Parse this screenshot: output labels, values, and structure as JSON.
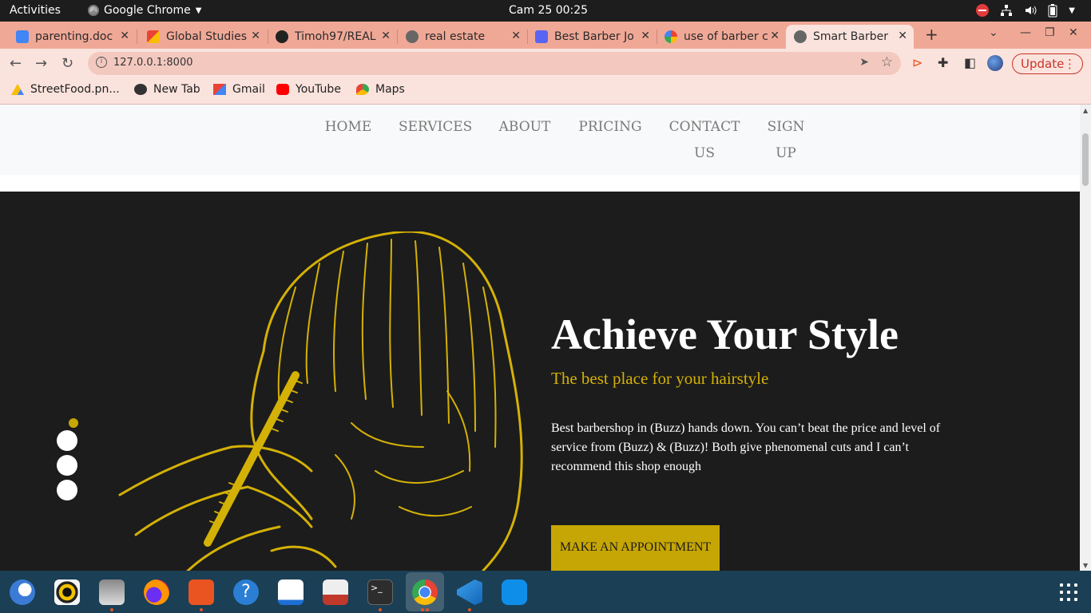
{
  "system_bar": {
    "activities": "Activities",
    "app_name": "Google Chrome",
    "clock": "Cam 25  00:25"
  },
  "tabs": [
    {
      "title": "parenting.doc",
      "favicon": "google-docs-icon",
      "color": "#4285f4"
    },
    {
      "title": "Global Studies",
      "favicon": "gmail-icon",
      "color": "#ea4335"
    },
    {
      "title": "Timoh97/REAL",
      "favicon": "github-icon",
      "color": "#222222"
    },
    {
      "title": "real estate",
      "favicon": "globe-icon",
      "color": "#555555"
    },
    {
      "title": "Best Barber Jo",
      "favicon": "wave-icon",
      "color": "#5865f2"
    },
    {
      "title": "use of barber c",
      "favicon": "google-icon",
      "color": "#4285f4"
    },
    {
      "title": "Smart Barber",
      "favicon": "globe-icon",
      "color": "#555555",
      "active": true
    }
  ],
  "address_bar": {
    "url": "127.0.0.1:8000",
    "update_label": "Update"
  },
  "bookmarks": [
    {
      "label": "StreetFood.pn...",
      "icon": "google-drive-icon"
    },
    {
      "label": "New Tab",
      "icon": "globe-icon"
    },
    {
      "label": "Gmail",
      "icon": "gmail-icon"
    },
    {
      "label": "YouTube",
      "icon": "youtube-icon"
    },
    {
      "label": "Maps",
      "icon": "maps-icon"
    }
  ],
  "site_nav": {
    "home": "HOME",
    "services": "SERVICES",
    "about": "ABOUT",
    "pricing": "PRICING",
    "contact_1": "CONTACT",
    "contact_2": "US",
    "signup_1": "SIGN",
    "signup_2": "UP"
  },
  "hero": {
    "title": "Achieve Your Style",
    "subtitle": "The best place for your hairstyle",
    "description": "Best barbershop in (Buzz) hands down. You can’t beat the price and level of service from (Buzz) & (Buzz)! Both give phenomenal cuts and I can’t recommend this shop enough",
    "cta_label": "MAKE AN APPOINTMENT"
  },
  "carousel": {
    "slide_count": 4,
    "active_index": 0
  },
  "colors": {
    "accent": "#c6a604",
    "hero_bg": "#1c1c1c",
    "tab_strip": "#f0a896",
    "toolbar": "#fbe3dd"
  },
  "taskbar_apps": [
    "thunderbird-icon",
    "rhythmbox-icon",
    "files-icon",
    "firefox-icon",
    "software-icon",
    "help-icon",
    "writer-icon",
    "document-viewer-icon",
    "terminal-icon",
    "chrome-icon",
    "vscode-icon",
    "teamviewer-icon"
  ]
}
